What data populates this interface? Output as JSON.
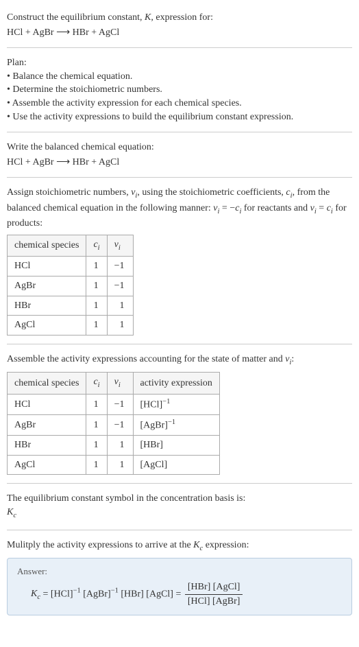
{
  "header": {
    "prompt": "Construct the equilibrium constant, K, expression for:",
    "equation": "HCl + AgBr ⟶ HBr + AgCl"
  },
  "plan": {
    "title": "Plan:",
    "items": [
      "Balance the chemical equation.",
      "Determine the stoichiometric numbers.",
      "Assemble the activity expression for each chemical species.",
      "Use the activity expressions to build the equilibrium constant expression."
    ]
  },
  "balanced": {
    "title": "Write the balanced chemical equation:",
    "equation": "HCl + AgBr ⟶ HBr + AgCl"
  },
  "stoich": {
    "intro_html": "Assign stoichiometric numbers, <span class=\"italic\">ν<span class=\"sub\">i</span></span>, using the stoichiometric coefficients, <span class=\"italic\">c<span class=\"sub\">i</span></span>, from the balanced chemical equation in the following manner: <span class=\"italic\">ν<span class=\"sub\">i</span></span> = −<span class=\"italic\">c<span class=\"sub\">i</span></span> for reactants and <span class=\"italic\">ν<span class=\"sub\">i</span></span> = <span class=\"italic\">c<span class=\"sub\">i</span></span> for products:",
    "headers": {
      "species": "chemical species",
      "ci_html": "<span class=\"italic\">c<span class=\"sub\">i</span></span>",
      "vi_html": "<span class=\"italic\">ν<span class=\"sub\">i</span></span>"
    },
    "rows": [
      {
        "species": "HCl",
        "ci": "1",
        "vi": "−1"
      },
      {
        "species": "AgBr",
        "ci": "1",
        "vi": "−1"
      },
      {
        "species": "HBr",
        "ci": "1",
        "vi": "1"
      },
      {
        "species": "AgCl",
        "ci": "1",
        "vi": "1"
      }
    ]
  },
  "activity": {
    "intro_html": "Assemble the activity expressions accounting for the state of matter and <span class=\"italic\">ν<span class=\"sub\">i</span></span>:",
    "headers": {
      "species": "chemical species",
      "ci_html": "<span class=\"italic\">c<span class=\"sub\">i</span></span>",
      "vi_html": "<span class=\"italic\">ν<span class=\"sub\">i</span></span>",
      "activity": "activity expression"
    },
    "rows": [
      {
        "species": "HCl",
        "ci": "1",
        "vi": "−1",
        "act_html": "[HCl]<span class=\"sup\">−1</span>"
      },
      {
        "species": "AgBr",
        "ci": "1",
        "vi": "−1",
        "act_html": "[AgBr]<span class=\"sup\">−1</span>"
      },
      {
        "species": "HBr",
        "ci": "1",
        "vi": "1",
        "act_html": "[HBr]"
      },
      {
        "species": "AgCl",
        "ci": "1",
        "vi": "1",
        "act_html": "[AgCl]"
      }
    ]
  },
  "symbol": {
    "title": "The equilibrium constant symbol in the concentration basis is:",
    "kc_html": "<span class=\"italic\">K<span class=\"sub\">c</span></span>"
  },
  "multiply": {
    "title_html": "Mulitply the activity expressions to arrive at the <span class=\"italic\">K<span class=\"sub\">c</span></span> expression:"
  },
  "answer": {
    "label": "Answer:",
    "expr_html": "<span class=\"italic\">K<span class=\"sub\">c</span></span> = [HCl]<span class=\"sup\">−1</span> [AgBr]<span class=\"sup\">−1</span> [HBr] [AgCl] = <span class=\"fraction\"><span class=\"num\">[HBr] [AgCl]</span><span class=\"den\">[HCl] [AgBr]</span></span>"
  }
}
